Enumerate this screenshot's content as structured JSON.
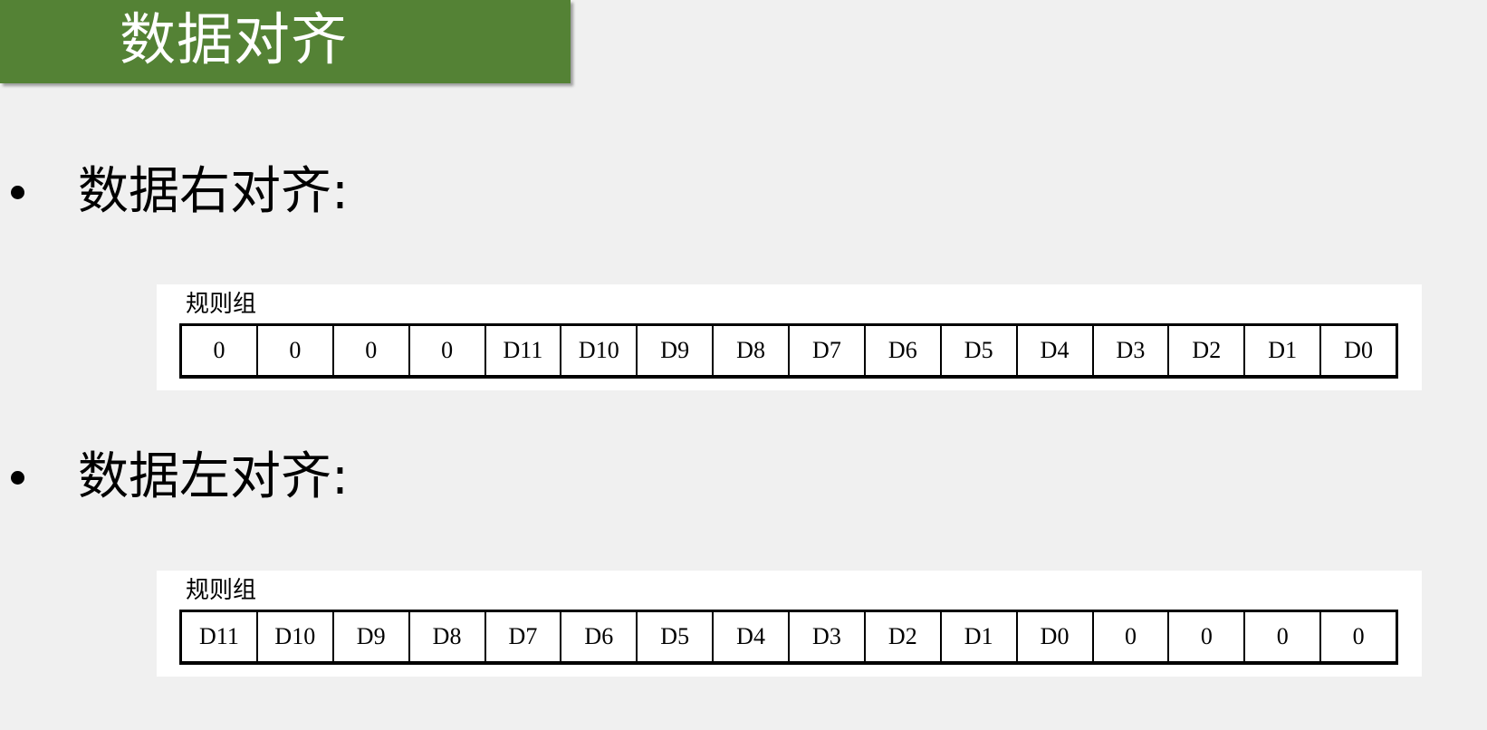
{
  "title": "数据对齐",
  "sections": [
    {
      "heading": "数据右对齐:",
      "register_label": "规则组",
      "cells": [
        "0",
        "0",
        "0",
        "0",
        "D11",
        "D10",
        "D9",
        "D8",
        "D7",
        "D6",
        "D5",
        "D4",
        "D3",
        "D2",
        "D1",
        "D0"
      ]
    },
    {
      "heading": "数据左对齐:",
      "register_label": "规则组",
      "cells": [
        "D11",
        "D10",
        "D9",
        "D8",
        "D7",
        "D6",
        "D5",
        "D4",
        "D3",
        "D2",
        "D1",
        "D0",
        "0",
        "0",
        "0",
        "0"
      ]
    }
  ],
  "colors": {
    "title_bar": "#548235",
    "background": "#f0f0f0"
  }
}
